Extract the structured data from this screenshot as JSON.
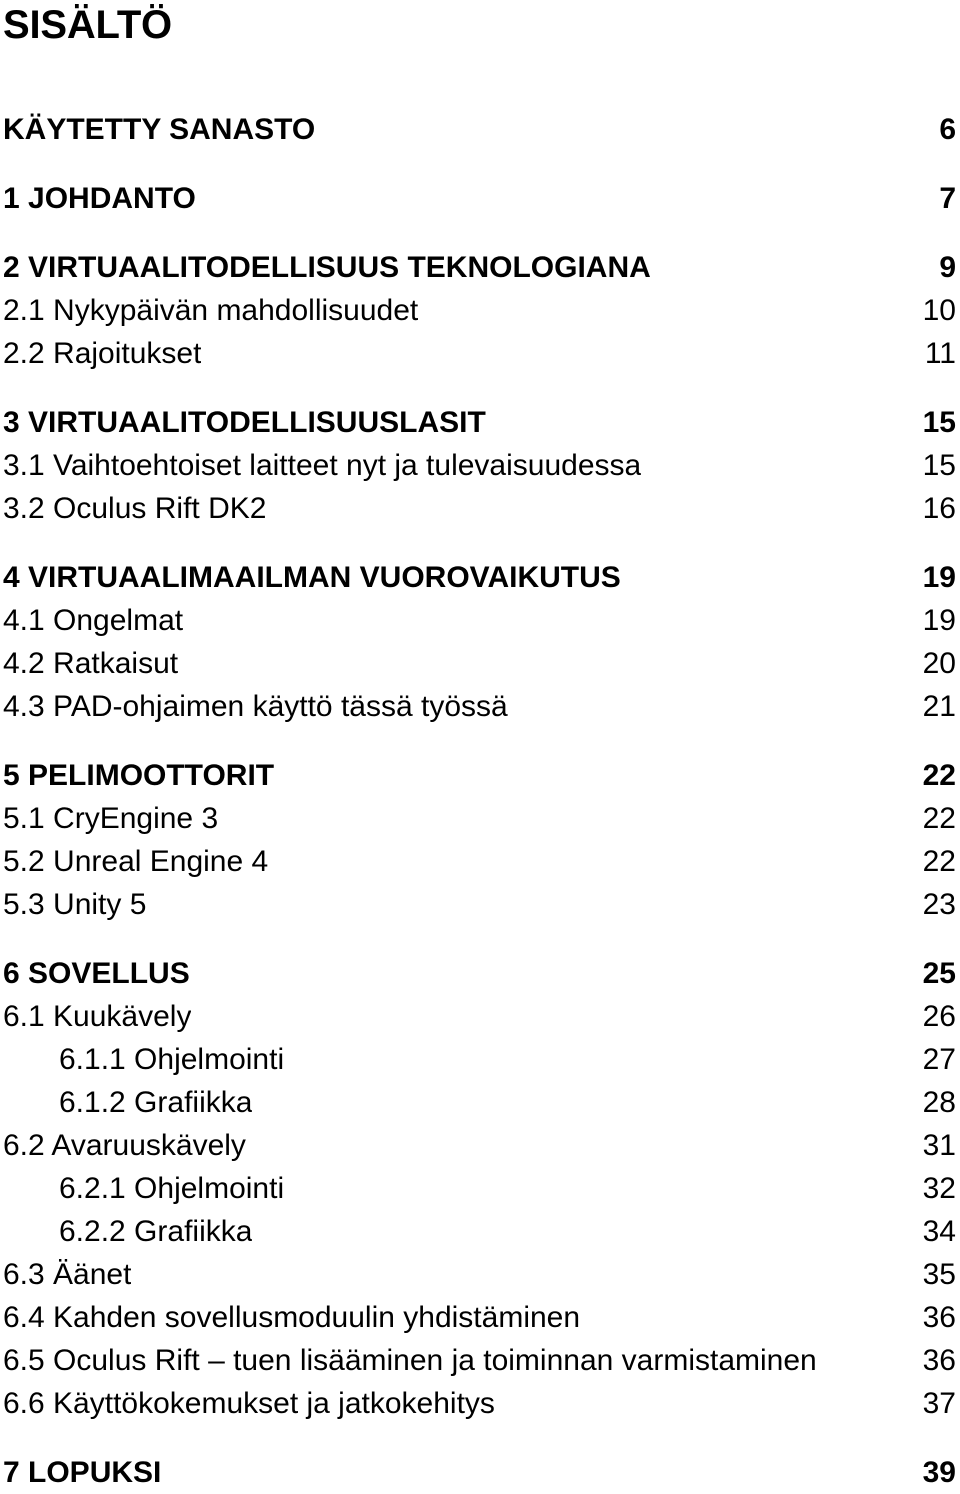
{
  "document": {
    "title": "SISÄLTÖ",
    "text_color": "#000000",
    "background_color": "#ffffff"
  },
  "toc": {
    "entries": [
      {
        "label": "KÄYTETTY SANASTO",
        "page": "6",
        "level": 1,
        "gap_before": false
      },
      {
        "label": "1 JOHDANTO",
        "page": "7",
        "level": 1,
        "gap_before": true
      },
      {
        "label": "2 VIRTUAALITODELLISUUS TEKNOLOGIANA",
        "page": "9",
        "level": 1,
        "gap_before": true
      },
      {
        "label": "2.1 Nykypäivän mahdollisuudet",
        "page": "10",
        "level": 2,
        "gap_before": false
      },
      {
        "label": "2.2 Rajoitukset",
        "page": "11",
        "level": 2,
        "gap_before": false
      },
      {
        "label": "3 VIRTUAALITODELLISUUSLASIT",
        "page": "15",
        "level": 1,
        "gap_before": true
      },
      {
        "label": "3.1 Vaihtoehtoiset laitteet nyt ja tulevaisuudessa",
        "page": "15",
        "level": 2,
        "gap_before": false
      },
      {
        "label": "3.2 Oculus Rift DK2",
        "page": "16",
        "level": 2,
        "gap_before": false
      },
      {
        "label": "4 VIRTUAALIMAAILMAN VUOROVAIKUTUS",
        "page": "19",
        "level": 1,
        "gap_before": true
      },
      {
        "label": "4.1 Ongelmat",
        "page": "19",
        "level": 2,
        "gap_before": false
      },
      {
        "label": "4.2 Ratkaisut",
        "page": "20",
        "level": 2,
        "gap_before": false
      },
      {
        "label": "4.3 PAD-ohjaimen käyttö tässä työssä",
        "page": "21",
        "level": 2,
        "gap_before": false
      },
      {
        "label": "5 PELIMOOTTORIT",
        "page": "22",
        "level": 1,
        "gap_before": true
      },
      {
        "label": "5.1 CryEngine 3",
        "page": "22",
        "level": 2,
        "gap_before": false
      },
      {
        "label": "5.2 Unreal Engine 4",
        "page": "22",
        "level": 2,
        "gap_before": false
      },
      {
        "label": "5.3 Unity 5",
        "page": "23",
        "level": 2,
        "gap_before": false
      },
      {
        "label": "6 SOVELLUS",
        "page": "25",
        "level": 1,
        "gap_before": true
      },
      {
        "label": "6.1 Kuukävely",
        "page": "26",
        "level": 2,
        "gap_before": false
      },
      {
        "label": "6.1.1 Ohjelmointi",
        "page": "27",
        "level": 3,
        "gap_before": false
      },
      {
        "label": "6.1.2 Grafiikka",
        "page": "28",
        "level": 3,
        "gap_before": false
      },
      {
        "label": "6.2 Avaruuskävely",
        "page": "31",
        "level": 2,
        "gap_before": false
      },
      {
        "label": "6.2.1 Ohjelmointi",
        "page": "32",
        "level": 3,
        "gap_before": false
      },
      {
        "label": "6.2.2 Grafiikka",
        "page": "34",
        "level": 3,
        "gap_before": false
      },
      {
        "label": "6.3 Äänet",
        "page": "35",
        "level": 2,
        "gap_before": false
      },
      {
        "label": "6.4 Kahden sovellusmoduulin yhdistäminen",
        "page": "36",
        "level": 2,
        "gap_before": false
      },
      {
        "label": "6.5 Oculus Rift – tuen lisääminen ja toiminnan varmistaminen",
        "page": "36",
        "level": 2,
        "gap_before": false
      },
      {
        "label": "6.6 Käyttökokemukset ja jatkokehitys",
        "page": "37",
        "level": 2,
        "gap_before": false
      },
      {
        "label": "7 LOPUKSI",
        "page": "39",
        "level": 1,
        "gap_before": true
      }
    ]
  }
}
